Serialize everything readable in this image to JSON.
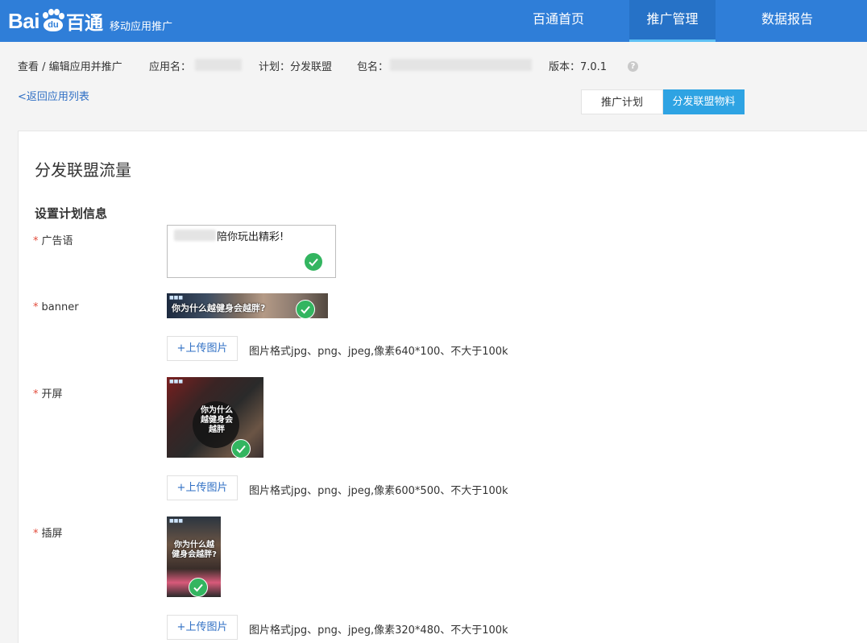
{
  "header": {
    "logo_text": "Bai",
    "logo_du": "du",
    "logo_cn": "百通",
    "subtitle": "移动应用推广",
    "nav": [
      {
        "label": "百通首页"
      },
      {
        "label": "推广管理"
      },
      {
        "label": "数据报告"
      }
    ]
  },
  "info": {
    "breadcrumb": "查看 / 编辑应用并推广",
    "app_name_label": "应用名：",
    "plan": "计划：分发联盟",
    "package_label": "包名：",
    "version": "版本：7.0.1",
    "help": "?"
  },
  "back_link": "<返回应用列表",
  "tabs": [
    {
      "label": "推广计划"
    },
    {
      "label": "分发联盟物料"
    }
  ],
  "card": {
    "title": "分发联盟流量",
    "section": "设置计划信息",
    "required_mark": "*",
    "fields": {
      "ad": {
        "label": "广告语",
        "value": "陪你玩出精彩!"
      },
      "banner": {
        "label": "banner",
        "upload": "+上传图片",
        "hint": "图片格式jpg、png、jpeg,像素640*100、不大于100k",
        "image_text": "你为什么越健身会越胖?"
      },
      "splash": {
        "label": "开屏",
        "upload": "+上传图片",
        "hint": "图片格式jpg、png、jpeg,像素600*500、不大于100k",
        "image_text": "你为什么越健身会越胖"
      },
      "interstitial": {
        "label": "插屏",
        "upload": "+上传图片",
        "hint": "图片格式jpg、png、jpeg,像素320*480、不大于100k",
        "image_text": "你为什么越健身会越胖?"
      }
    }
  }
}
